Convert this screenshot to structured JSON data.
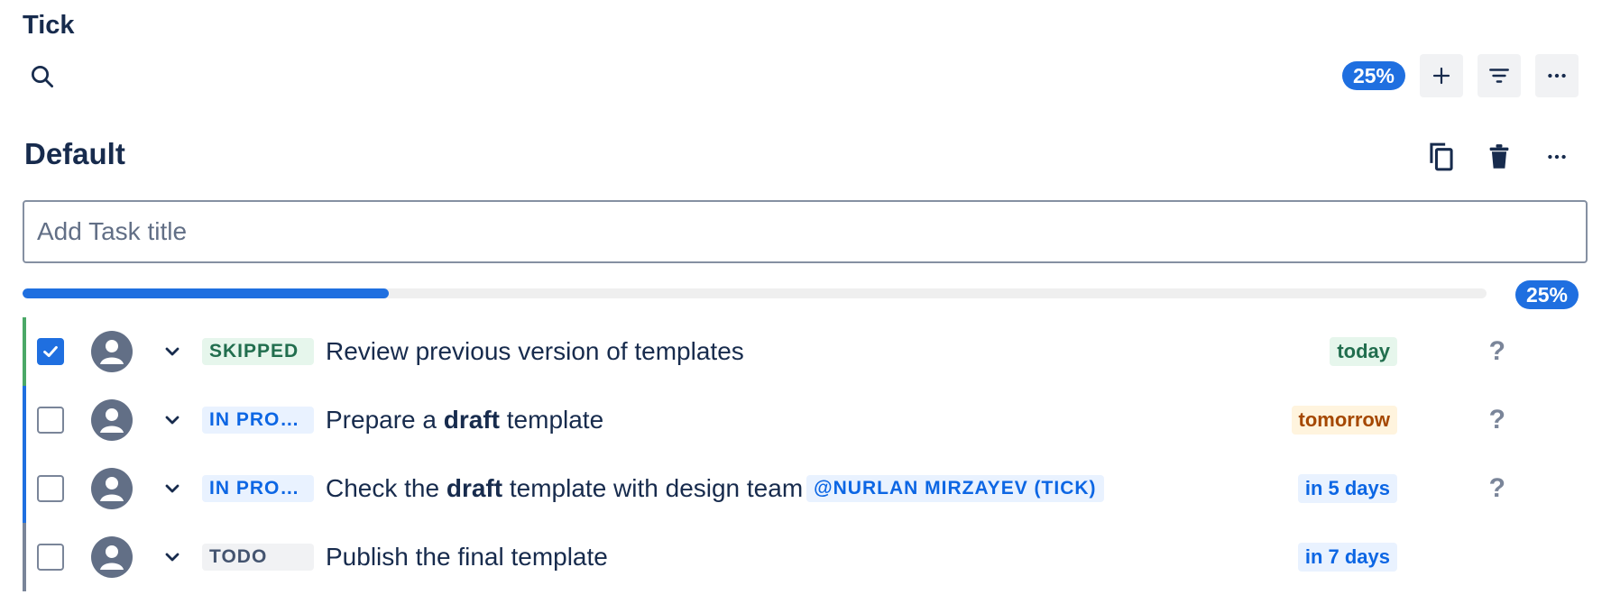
{
  "app": {
    "title": "Tick"
  },
  "toolbar": {
    "progress_label": "25%",
    "add_icon": "plus-icon",
    "filter_icon": "filter-icon",
    "more_icon": "more-horizontal-icon"
  },
  "list": {
    "title": "Default",
    "copy_icon": "copy-icon",
    "delete_icon": "trash-icon",
    "more_icon": "more-horizontal-icon",
    "input_placeholder": "Add Task title",
    "input_value": "",
    "progress": 0.25,
    "progress_label": "25%"
  },
  "tasks": [
    {
      "checked": true,
      "status": "SKIPPED",
      "text_parts": [
        {
          "t": "Review previous version of templates"
        }
      ],
      "due": "today",
      "help": "?"
    },
    {
      "checked": false,
      "status": "IN PROGRESS",
      "text_parts": [
        {
          "t": "Prepare a "
        },
        {
          "t": "draft",
          "b": true
        },
        {
          "t": " template"
        }
      ],
      "due": "tomorrow",
      "help": "?"
    },
    {
      "checked": false,
      "status": "IN PROGRESS",
      "text_parts": [
        {
          "t": "Check the "
        },
        {
          "t": "draft",
          "b": true
        },
        {
          "t": " template with design team"
        }
      ],
      "mention": "@NURLAN MIRZAYEV (TICK)",
      "due": "in 5 days",
      "help": "?"
    },
    {
      "checked": false,
      "status": "TODO",
      "text_parts": [
        {
          "t": "Publish the final template"
        }
      ],
      "due": "in 7 days",
      "help": ""
    }
  ],
  "colors": {
    "accent": "#1F6FE0",
    "skipped": "#4BA867",
    "todo": "#7A8599",
    "due_today": "#216E4E",
    "due_tomorrow": "#A54800",
    "due_later": "#0C66E4"
  }
}
